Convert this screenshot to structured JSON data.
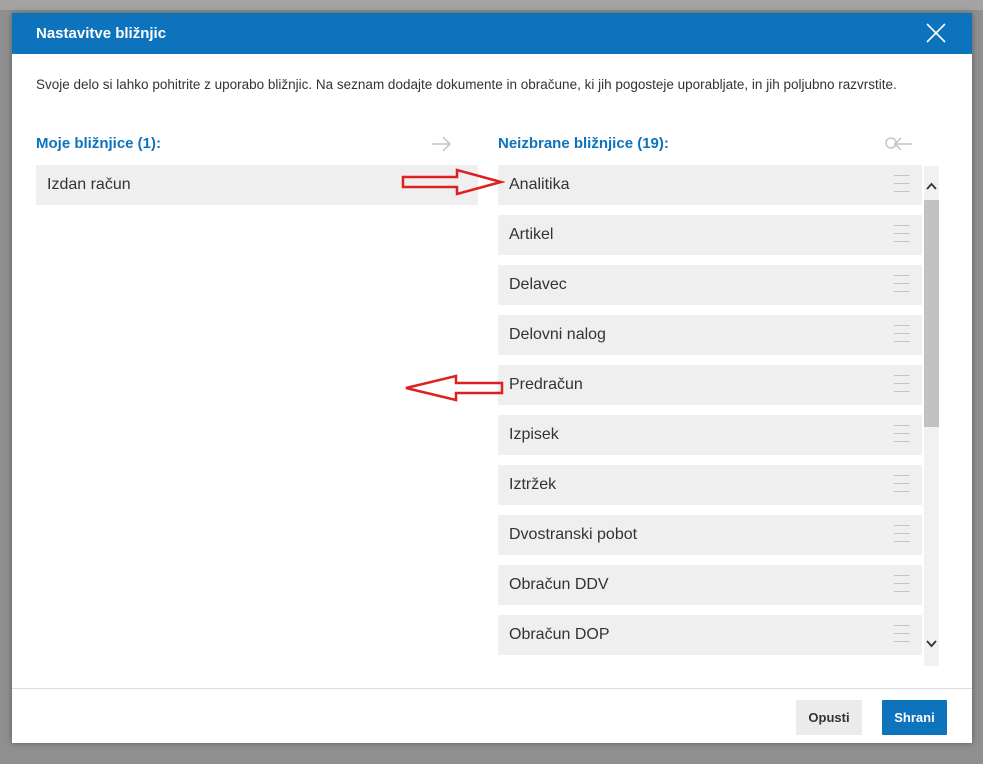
{
  "dialog": {
    "title": "Nastavitve bližnjic",
    "description": "Svoje delo si lahko pohitrite z uporabo bližnjic. Na seznam dodajte dokumente in obračune, ki jih pogosteje uporabljate, in jih poljubno razvrstite."
  },
  "my_shortcuts": {
    "title": "Moje bližnjice (1):",
    "items": [
      "Izdan račun"
    ]
  },
  "unselected_shortcuts": {
    "title": "Neizbrane bližnjice (19):",
    "items": [
      "Analitika",
      "Artikel",
      "Delavec",
      "Delovni nalog",
      "Predračun",
      "Izpisek",
      "Iztržek",
      "Dvostranski pobot",
      "Obračun DDV",
      "Obračun DOP"
    ]
  },
  "footer": {
    "cancel_label": "Opusti",
    "save_label": "Shrani"
  },
  "colors": {
    "accent": "#0d73bd",
    "annotation": "#e02020"
  }
}
